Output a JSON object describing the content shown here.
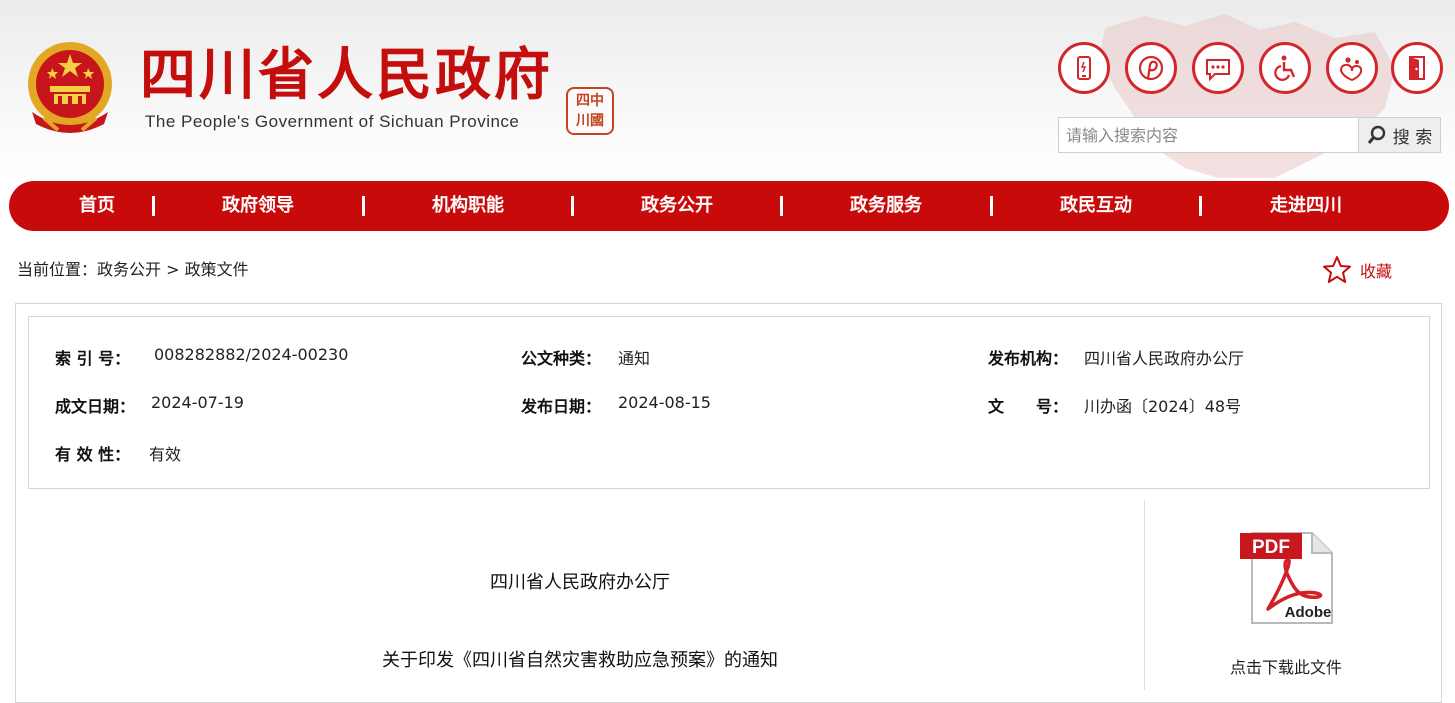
{
  "header": {
    "title": "四川省人民政府",
    "subtitle": "The People's Government of Sichuan Province",
    "seal_chars": [
      "四",
      "中",
      "川",
      "國"
    ],
    "icons": [
      "mobile-icon",
      "weibo-icon",
      "message-icon",
      "accessibility-icon",
      "care-icon",
      "exit-icon"
    ],
    "search": {
      "placeholder": "请输入搜索内容",
      "button_label": "搜 索"
    }
  },
  "nav": {
    "items": [
      {
        "label": "首页"
      },
      {
        "label": "政府领导"
      },
      {
        "label": "机构职能"
      },
      {
        "label": "政务公开"
      },
      {
        "label": "政务服务"
      },
      {
        "label": "政民互动"
      },
      {
        "label": "走进四川"
      }
    ]
  },
  "breadcrumb": {
    "prefix": "当前位置：",
    "level1": "政务公开",
    "separator": " > ",
    "level2": "政策文件"
  },
  "favorite": {
    "label": "收藏"
  },
  "meta": {
    "index_label": "索 引 号：",
    "index_value": "008282882/2024-00230",
    "type_label": "公文种类：",
    "type_value": "通知",
    "org_label": "发布机构：",
    "org_value": "四川省人民政府办公厅",
    "created_label": "成文日期：",
    "created_value": "2024-07-19",
    "published_label": "发布日期：",
    "published_value": "2024-08-15",
    "docno_label": "文　　号：",
    "docno_value": "川办函〔2024〕48号",
    "validity_label": "有 效 性：",
    "validity_value": "有效"
  },
  "document": {
    "issuer": "四川省人民政府办公厅",
    "title": "关于印发《四川省自然灾害救助应急预案》的通知"
  },
  "download": {
    "pdf_badge": "PDF",
    "pdf_brand": "Adobe",
    "label": "点击下载此文件"
  },
  "colors": {
    "brand_red": "#c90a0a",
    "title_red": "#c40d0d"
  }
}
